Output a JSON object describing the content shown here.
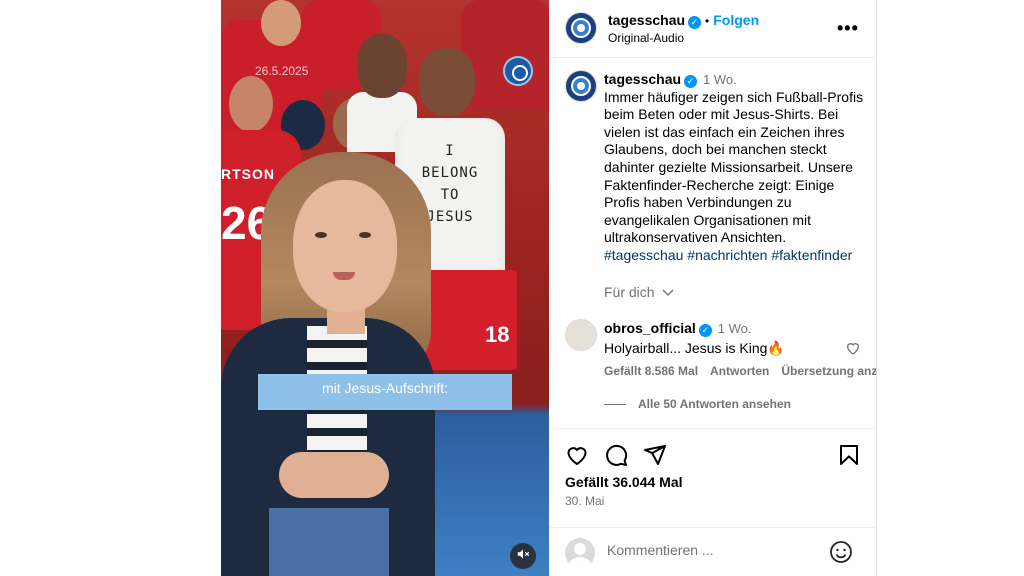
{
  "media": {
    "date_overlay": "26.5.2025",
    "tank_text": "I\nBELONG\nTO\nJESUS",
    "shirt_name": "RTSON",
    "shirt_number": "26",
    "shorts_number": "18",
    "subtitle": "mit Jesus-Aufschrift:",
    "icons": {
      "mute": "speaker-muted-icon"
    }
  },
  "header": {
    "username": "tagesschau",
    "separator": "•",
    "follow_label": "Folgen",
    "audio": "Original-Audio",
    "more_label": "•••"
  },
  "post": {
    "username": "tagesschau",
    "time": "1 Wo.",
    "caption": "Immer häufiger zeigen sich Fußball-Profis beim Beten oder mit Jesus-Shirts. Bei vielen ist das einfach ein Zeichen ihres Glaubens, doch bei manchen steckt dahinter gezielte Missionsarbeit. Unsere Faktenfinder-Recherche zeigt: Einige Profis haben Verbindungen zu evangelikalen Organisationen mit ultrakonservativen Ansichten.",
    "hashtags": "#tagesschau #nachrichten #faktenfinder",
    "fuer_dich": "Für dich"
  },
  "comment": {
    "username": "obros_official",
    "time": "1 Wo.",
    "text": "Holyairball... Jesus is King🔥",
    "likes": "Gefällt 8.586 Mal",
    "reply_label": "Antworten",
    "translation_label": "Übersetzung anzeigen",
    "view_replies": "Alle 50 Antworten ansehen"
  },
  "actions": {
    "likes": "Gefällt 36.044 Mal",
    "date": "30. Mai",
    "icons": [
      "heart-icon",
      "comment-icon",
      "share-icon",
      "bookmark-icon"
    ]
  },
  "comment_bar": {
    "placeholder": "Kommentieren ...",
    "emoji_icon": "emoji-icon"
  },
  "colors": {
    "link_blue": "#0095f6",
    "hashtag": "#00376b",
    "muted": "#737373",
    "verified": "#0095f6",
    "subtitle_bar": "#8ec0ea"
  }
}
